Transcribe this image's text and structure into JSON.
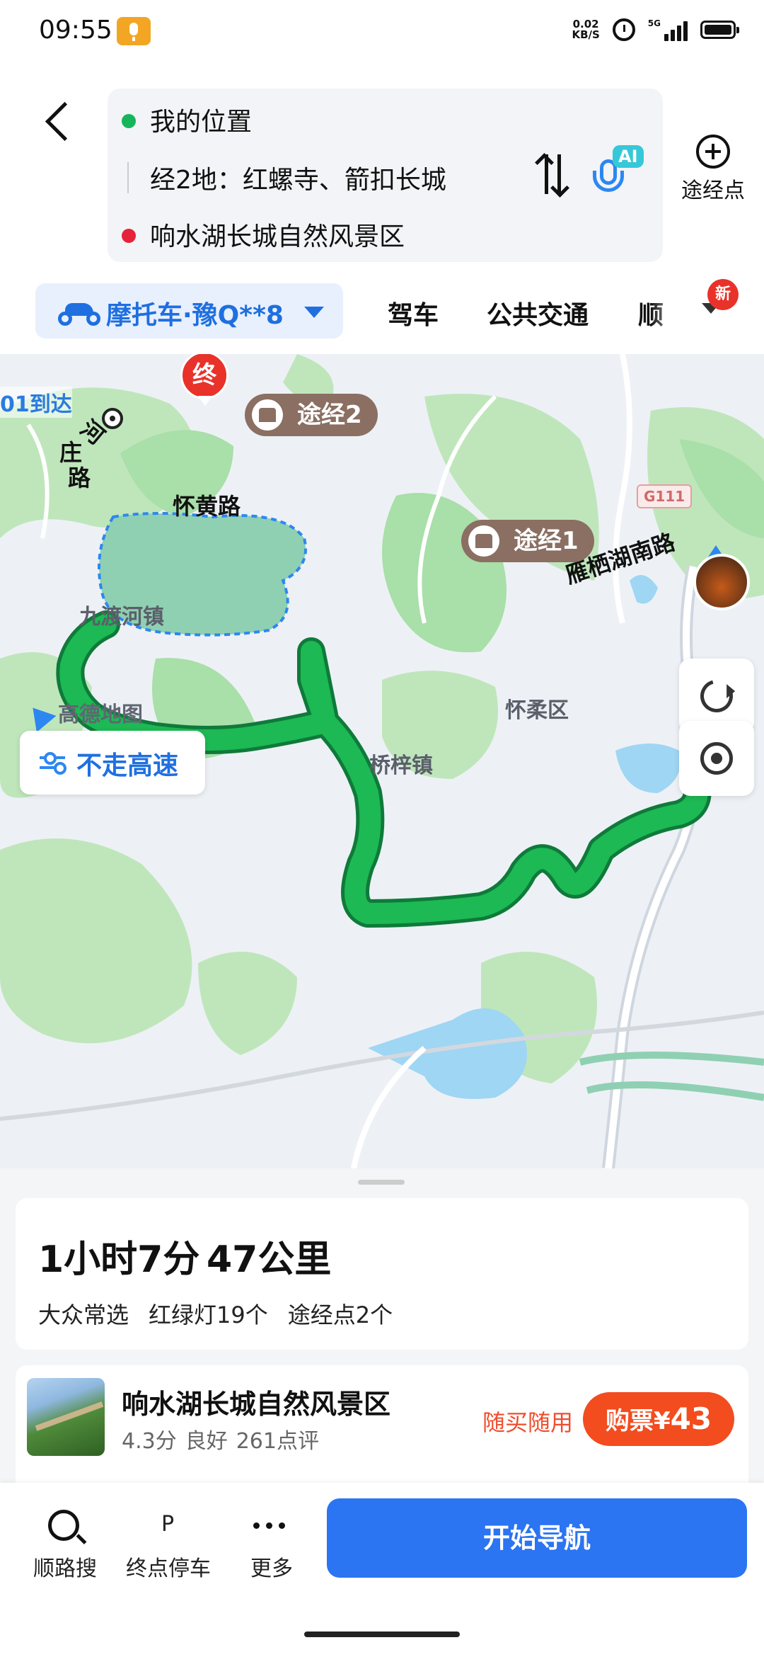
{
  "status_bar": {
    "time": "09:55",
    "net_speed_value": "0.02",
    "net_speed_unit": "KB/S",
    "signal_label": "5G",
    "icons": [
      "microphone-icon",
      "alarm-icon",
      "signal-icon",
      "battery-icon"
    ]
  },
  "route": {
    "start": "我的位置",
    "via": "经2地：红螺寺、箭扣长城",
    "destination": "响水湖长城自然风景区",
    "ai_label": "AI",
    "add_waypoint_label": "途经点"
  },
  "modes": {
    "selected": "摩托车·豫Q**8",
    "tabs": [
      "驾车",
      "公共交通",
      "顺"
    ],
    "new_badge": "新"
  },
  "map": {
    "end_marker": "终",
    "waypoints": [
      "途经1",
      "途经2"
    ],
    "arrive_label": "01到达",
    "road_labels": [
      "怀黄路",
      "雁栖湖南路"
    ],
    "road_vertical": [
      "河",
      "庄",
      "路"
    ],
    "place_labels": [
      "九渡河镇",
      "怀柔区",
      "桥梓镇"
    ],
    "road_shield": "G111",
    "provider": "高德地图",
    "avoid_highway": "不走高速",
    "colors": {
      "route": "#1db954",
      "park": "#a9dfa8",
      "water": "#9fd6f3"
    }
  },
  "summary": {
    "duration": "1小时7分",
    "distance": "47公里",
    "tags": [
      "大众常选",
      "红绿灯19个",
      "途经点2个"
    ]
  },
  "poi": {
    "name": "响水湖长城自然风景区",
    "score": "4.3分",
    "rating_text": "良好",
    "reviews": "261点评",
    "buy_anytime": "随买随用",
    "buy_label": "购票",
    "price_symbol": "¥",
    "price": "43"
  },
  "bottom_bar": {
    "items": [
      "顺路搜",
      "终点停车",
      "更多"
    ],
    "p_glyph": "P",
    "start_nav": "开始导航"
  }
}
